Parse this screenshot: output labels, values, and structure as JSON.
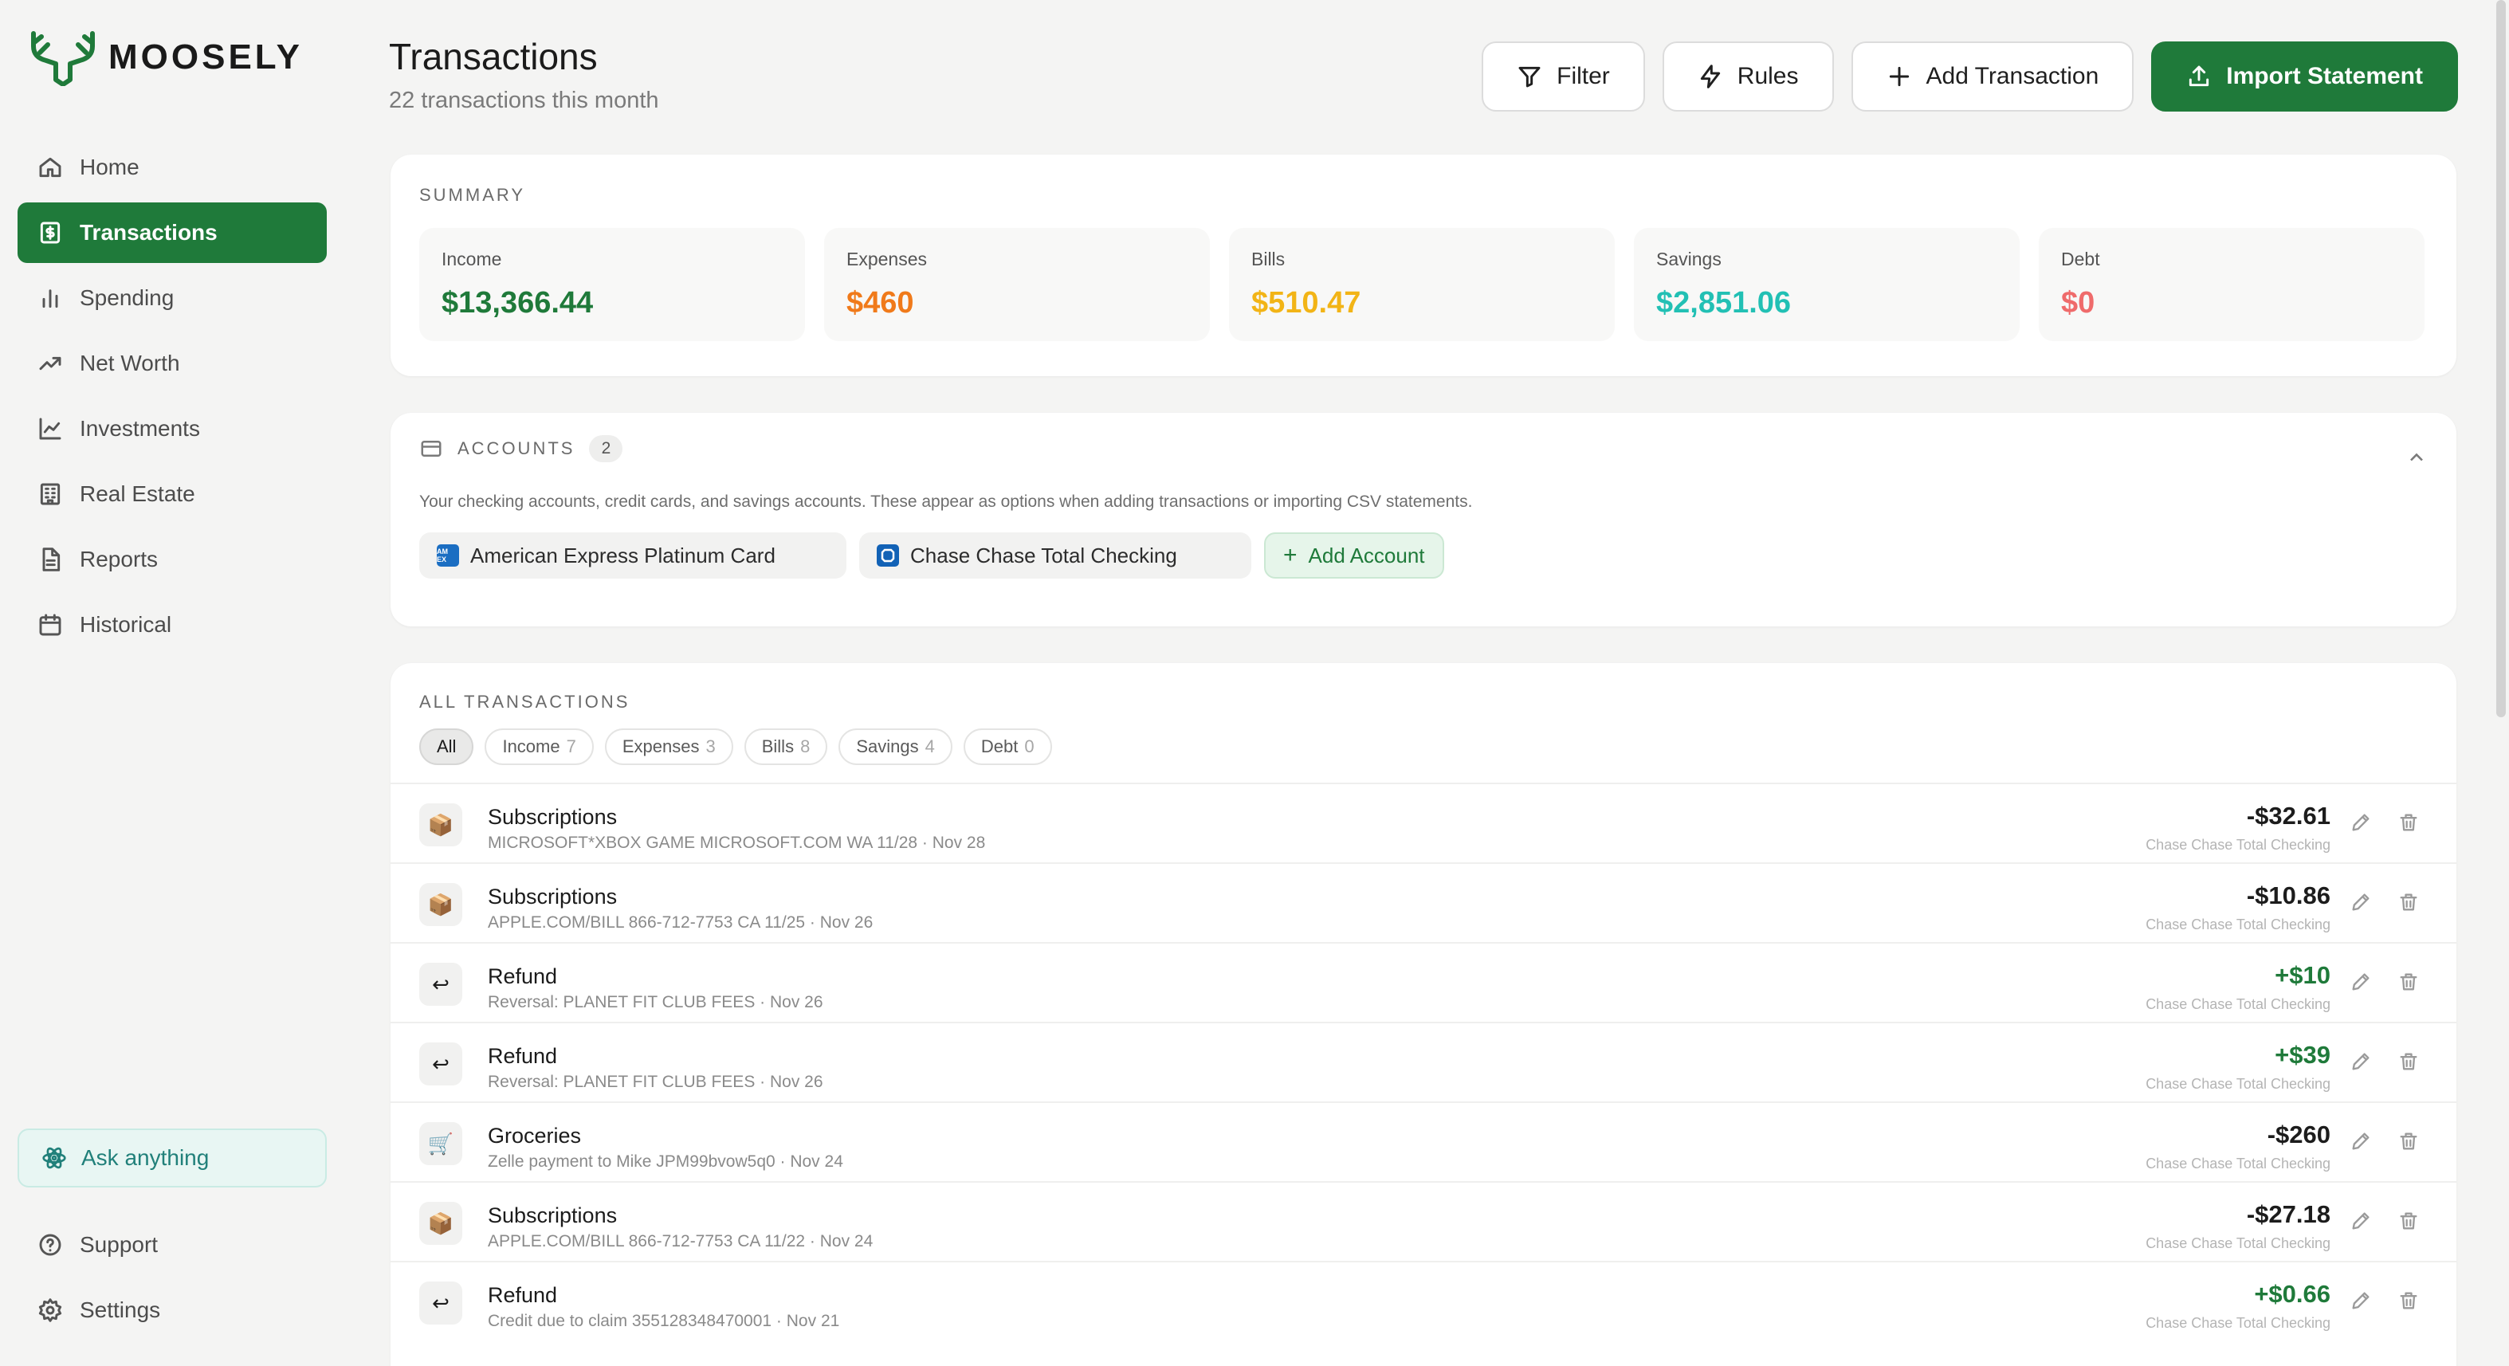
{
  "brand": {
    "name": "MOOSELY",
    "accent": "#1f7a3a"
  },
  "sidebar": {
    "items": [
      {
        "label": "Home",
        "icon": "home-icon"
      },
      {
        "label": "Transactions",
        "icon": "dollar-file-icon",
        "active": true
      },
      {
        "label": "Spending",
        "icon": "bar-chart-icon"
      },
      {
        "label": "Net Worth",
        "icon": "trending-up-icon"
      },
      {
        "label": "Investments",
        "icon": "line-chart-icon"
      },
      {
        "label": "Real Estate",
        "icon": "building-icon"
      },
      {
        "label": "Reports",
        "icon": "document-icon"
      },
      {
        "label": "Historical",
        "icon": "calendar-icon"
      }
    ],
    "ask": "Ask anything",
    "bottom": [
      {
        "label": "Support",
        "icon": "help-circle-icon"
      },
      {
        "label": "Settings",
        "icon": "gear-icon"
      }
    ]
  },
  "header": {
    "title": "Transactions",
    "subtitle": "22 transactions this month",
    "buttons": {
      "filter": "Filter",
      "rules": "Rules",
      "add": "Add Transaction",
      "import": "Import Statement"
    }
  },
  "summary": {
    "label": "SUMMARY",
    "stats": [
      {
        "label": "Income",
        "value": "$13,366.44",
        "color": "#1f7a3a"
      },
      {
        "label": "Expenses",
        "value": "$460",
        "color": "#f07a1a"
      },
      {
        "label": "Bills",
        "value": "$510.47",
        "color": "#f2b416"
      },
      {
        "label": "Savings",
        "value": "$2,851.06",
        "color": "#22c0b4"
      },
      {
        "label": "Debt",
        "value": "$0",
        "color": "#ef6b6b"
      }
    ]
  },
  "accounts": {
    "label": "ACCOUNTS",
    "count": "2",
    "description": "Your checking accounts, credit cards, and savings accounts. These appear as options when adding transactions or importing CSV statements.",
    "items": [
      {
        "name": "American Express Platinum Card",
        "logo_text": "AM EX",
        "logo_color": "#1b6ec2"
      },
      {
        "name": "Chase Chase Total Checking",
        "logo_text": "",
        "logo_color": "#1262b6"
      }
    ],
    "add_label": "Add Account"
  },
  "transactions": {
    "label": "ALL TRANSACTIONS",
    "filters": [
      {
        "label": "All",
        "count": "",
        "active": true
      },
      {
        "label": "Income",
        "count": "7"
      },
      {
        "label": "Expenses",
        "count": "3"
      },
      {
        "label": "Bills",
        "count": "8"
      },
      {
        "label": "Savings",
        "count": "4"
      },
      {
        "label": "Debt",
        "count": "0"
      }
    ],
    "rows": [
      {
        "icon": "📦",
        "title": "Subscriptions",
        "sub": "MICROSOFT*XBOX GAME MICROSOFT.COM WA 11/28 · Nov 28",
        "amount": "-$32.61",
        "positive": false,
        "account": "Chase Chase Total Checking"
      },
      {
        "icon": "📦",
        "title": "Subscriptions",
        "sub": "APPLE.COM/BILL 866-712-7753 CA 11/25 · Nov 26",
        "amount": "-$10.86",
        "positive": false,
        "account": "Chase Chase Total Checking"
      },
      {
        "icon": "↩",
        "title": "Refund",
        "sub": "Reversal: PLANET FIT CLUB FEES · Nov 26",
        "amount": "+$10",
        "positive": true,
        "account": "Chase Chase Total Checking"
      },
      {
        "icon": "↩",
        "title": "Refund",
        "sub": "Reversal: PLANET FIT CLUB FEES · Nov 26",
        "amount": "+$39",
        "positive": true,
        "account": "Chase Chase Total Checking"
      },
      {
        "icon": "🛒",
        "title": "Groceries",
        "sub": "Zelle payment to Mike JPM99bvow5q0 · Nov 24",
        "amount": "-$260",
        "positive": false,
        "account": "Chase Chase Total Checking"
      },
      {
        "icon": "📦",
        "title": "Subscriptions",
        "sub": "APPLE.COM/BILL 866-712-7753 CA 11/22 · Nov 24",
        "amount": "-$27.18",
        "positive": false,
        "account": "Chase Chase Total Checking"
      },
      {
        "icon": "↩",
        "title": "Refund",
        "sub": "Credit due to claim 355128348470001 · Nov 21",
        "amount": "+$0.66",
        "positive": true,
        "account": "Chase Chase Total Checking"
      }
    ]
  }
}
